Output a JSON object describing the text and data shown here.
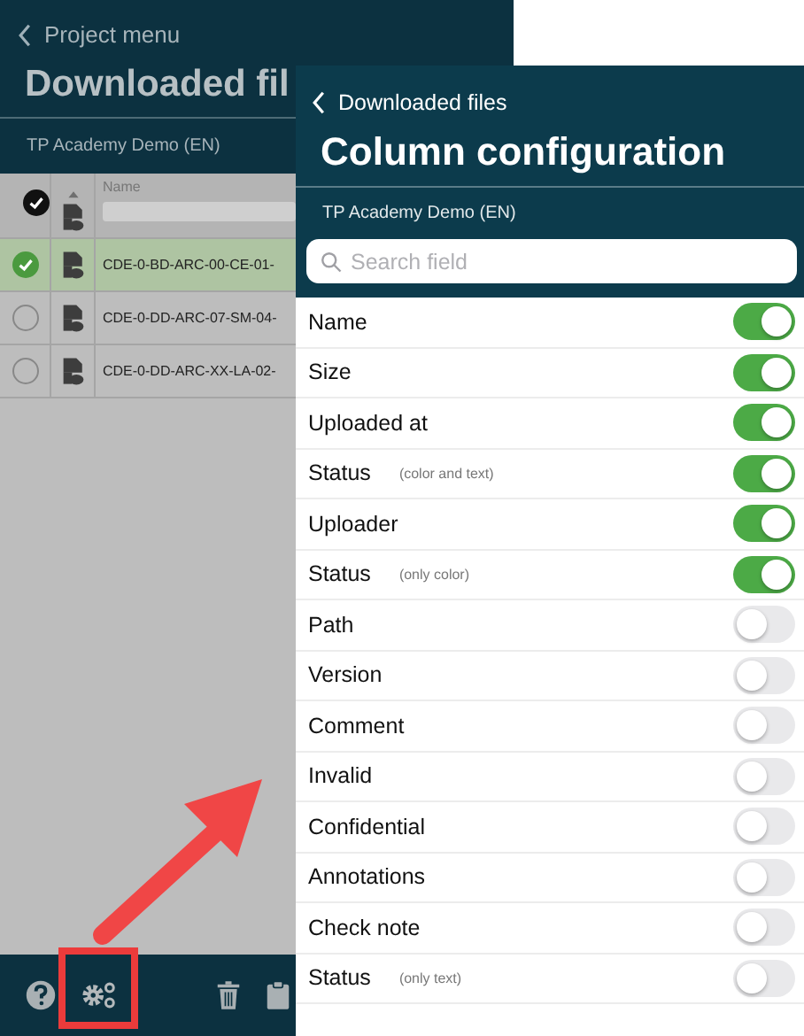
{
  "background": {
    "back_label": "Project menu",
    "title": "Downloaded fil",
    "project": "TP Academy Demo (EN)",
    "table": {
      "select_all_checked": true,
      "columns": [
        {
          "label": "Name"
        }
      ],
      "rows": [
        {
          "name": "CDE-0-BD-ARC-00-CE-01-",
          "selected": true
        },
        {
          "name": "CDE-0-DD-ARC-07-SM-04-",
          "selected": false
        },
        {
          "name": "CDE-0-DD-ARC-XX-LA-02-",
          "selected": false
        }
      ]
    }
  },
  "sheet": {
    "back_label": "Downloaded files",
    "title": "Column configuration",
    "project": "TP Academy Demo (EN)",
    "search": {
      "placeholder": "Search field"
    },
    "columns": [
      {
        "label": "Name",
        "on": true
      },
      {
        "label": "Size",
        "on": true
      },
      {
        "label": "Uploaded at",
        "on": true
      },
      {
        "label": "Status",
        "note": "(color and text)",
        "on": true
      },
      {
        "label": "Uploader",
        "on": true
      },
      {
        "label": "Status",
        "note": "(only color)",
        "on": true
      },
      {
        "label": "Path",
        "on": false
      },
      {
        "label": "Version",
        "on": false
      },
      {
        "label": "Comment",
        "on": false
      },
      {
        "label": "Invalid",
        "on": false
      },
      {
        "label": "Confidential",
        "on": false
      },
      {
        "label": "Annotations",
        "on": false
      },
      {
        "label": "Check note",
        "on": false
      },
      {
        "label": "Status",
        "note": "(only text)",
        "on": false
      }
    ]
  }
}
